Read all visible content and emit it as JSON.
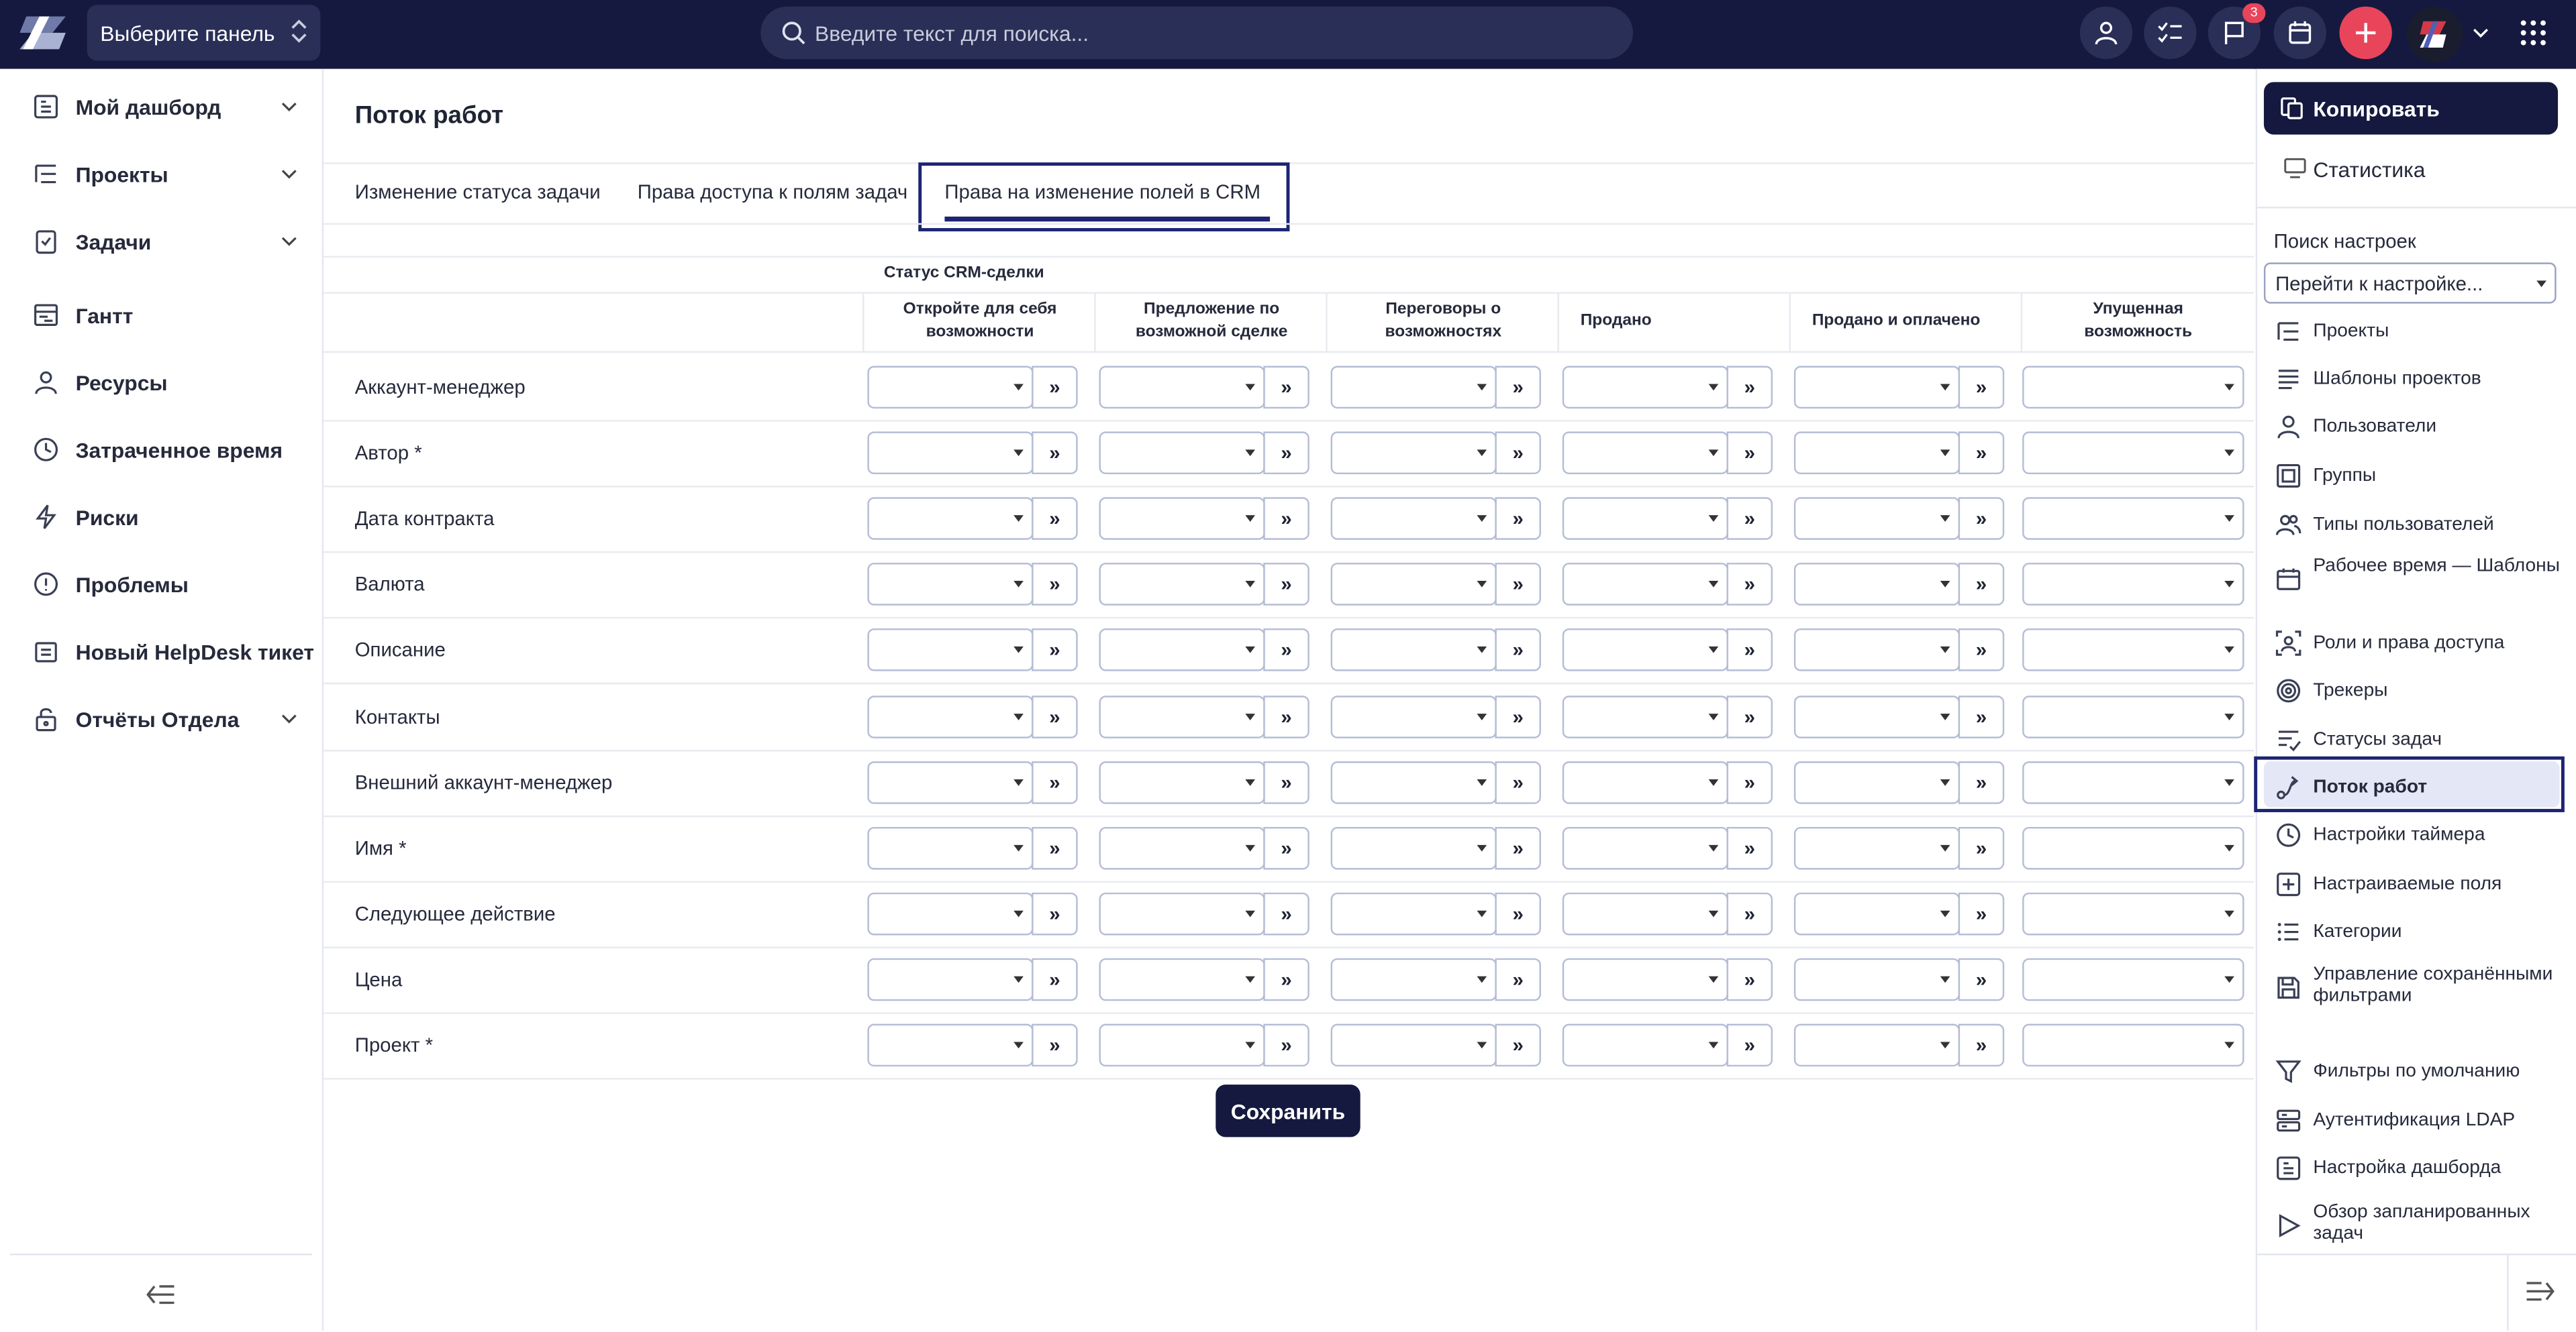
{
  "topbar": {
    "panel_select": "Выберите панель",
    "search_placeholder": "Введите текст для поиска...",
    "notifications_count": "3"
  },
  "sidebar": {
    "items": [
      {
        "label": "Мой дашборд",
        "icon": "dashboard-icon",
        "has_chevron": true
      },
      {
        "label": "Проекты",
        "icon": "projects-icon",
        "has_chevron": true
      },
      {
        "label": "Задачи",
        "icon": "tasks-icon",
        "has_chevron": true
      },
      {
        "label": "Гантт",
        "icon": "gantt-icon",
        "has_chevron": false
      },
      {
        "label": "Ресурсы",
        "icon": "user-icon",
        "has_chevron": false
      },
      {
        "label": "Затраченное время",
        "icon": "clock-icon",
        "has_chevron": false
      },
      {
        "label": "Риски",
        "icon": "lightning-icon",
        "has_chevron": false
      },
      {
        "label": "Проблемы",
        "icon": "alert-icon",
        "has_chevron": false
      },
      {
        "label": "Новый HelpDesk тикет",
        "icon": "ticket-icon",
        "has_chevron": false
      },
      {
        "label": "Отчёты Отдела",
        "icon": "lock-icon",
        "has_chevron": true
      }
    ]
  },
  "main": {
    "title": "Поток работ",
    "tabs": [
      {
        "label": "Изменение статуса задачи",
        "active": false
      },
      {
        "label": "Права доступа к полям задач",
        "active": false
      },
      {
        "label": "Права на изменение полей в CRM",
        "active": true
      }
    ],
    "group_header": "Статус CRM-сделки",
    "columns": [
      {
        "line1": "Откройте для себя",
        "line2": "возможности"
      },
      {
        "line1": "Предложение по",
        "line2": "возможной сделке"
      },
      {
        "line1": "Переговоры о",
        "line2": "возможностях"
      },
      {
        "line1": "Продано",
        "line2": ""
      },
      {
        "line1": "Продано и оплачено",
        "line2": ""
      },
      {
        "line1": "Упущенная",
        "line2": "возможность"
      }
    ],
    "rows": [
      "Аккаунт-менеджер",
      "Автор *",
      "Дата контракта",
      "Валюта",
      "Описание",
      "Контакты",
      "Внешний аккаунт-менеджер",
      "Имя *",
      "Следующее действие",
      "Цена",
      "Проект *"
    ],
    "copy_arrow": "»",
    "save_label": "Сохранить"
  },
  "right_panel": {
    "copy_label": "Копировать",
    "stats_label": "Статистика",
    "search_label": "Поиск настроек",
    "search_select": "Перейти к настройке...",
    "items": [
      {
        "label": "Проекты",
        "icon": "projects-icon"
      },
      {
        "label": "Шаблоны проектов",
        "icon": "template-icon"
      },
      {
        "label": "Пользователи",
        "icon": "user-icon"
      },
      {
        "label": "Группы",
        "icon": "group-icon"
      },
      {
        "label": "Типы пользователей",
        "icon": "users-icon"
      },
      {
        "label": "Рабочее время — Шаблоны",
        "icon": "calendar-icon"
      },
      {
        "label": "Роли и права доступа",
        "icon": "roles-icon"
      },
      {
        "label": "Трекеры",
        "icon": "target-icon"
      },
      {
        "label": "Статусы задач",
        "icon": "status-icon"
      },
      {
        "label": "Поток работ",
        "icon": "workflow-icon",
        "active": true
      },
      {
        "label": "Настройки таймера",
        "icon": "clock-icon"
      },
      {
        "label": "Настраиваемые поля",
        "icon": "plus-square-icon"
      },
      {
        "label": "Категории",
        "icon": "list-icon"
      },
      {
        "label": "Управление сохранёнными фильтрами",
        "icon": "save-icon"
      },
      {
        "label": "Фильтры по умолчанию",
        "icon": "filter-icon"
      },
      {
        "label": "Аутентификация LDAP",
        "icon": "server-icon"
      },
      {
        "label": "Настройка дашборда",
        "icon": "dashboard-icon"
      },
      {
        "label": "Обзор запланированных задач",
        "icon": "play-icon"
      }
    ]
  },
  "colors": {
    "topbar": "#15193f",
    "accent": "#1c2473",
    "danger": "#e8455b"
  }
}
